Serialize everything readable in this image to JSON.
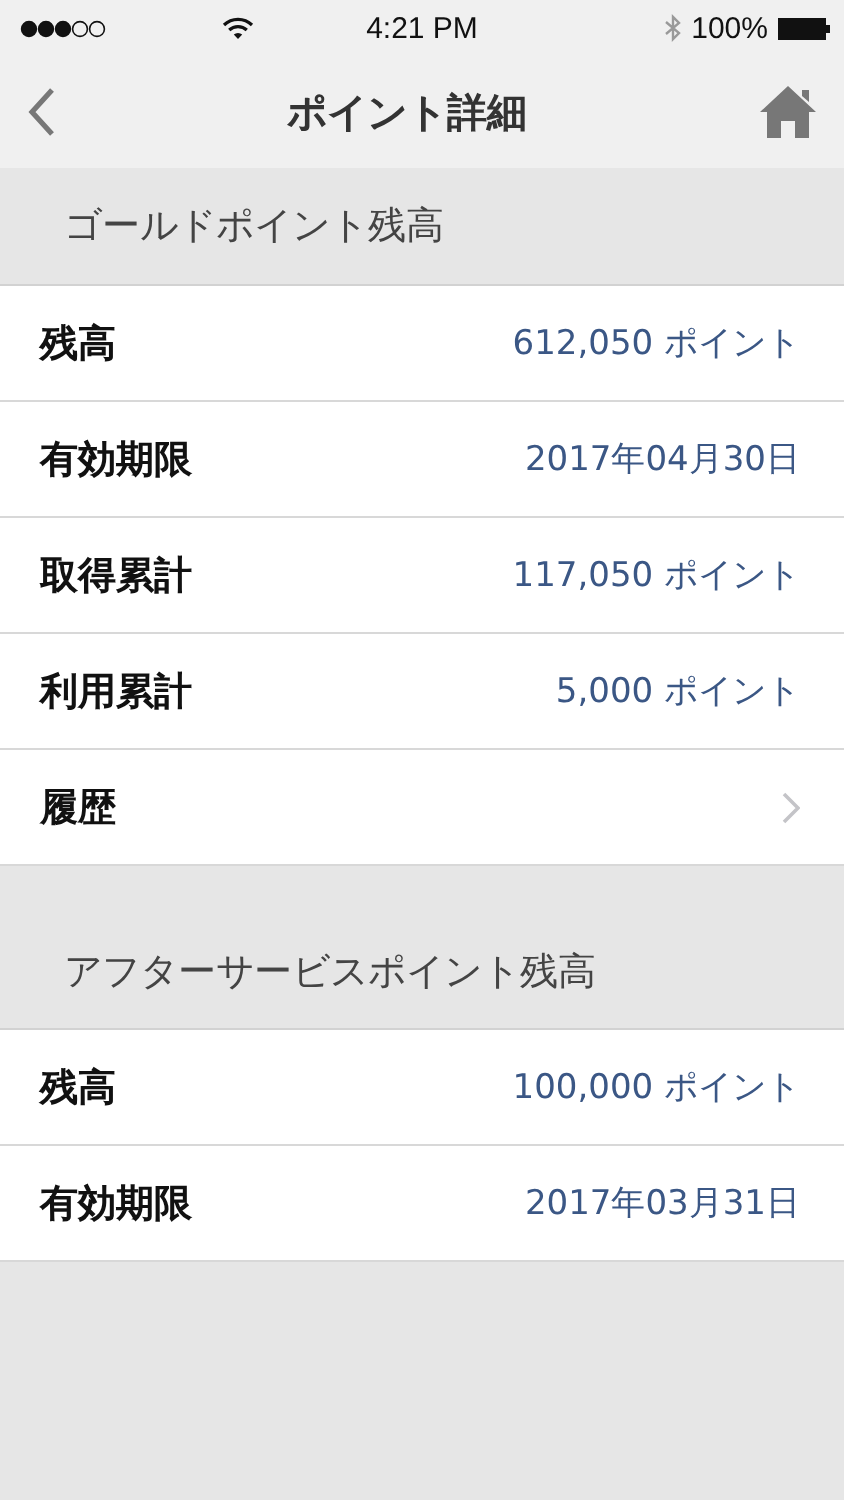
{
  "status_bar": {
    "time": "4:21 PM",
    "battery": "100%"
  },
  "nav": {
    "title": "ポイント詳細"
  },
  "sections": [
    {
      "title": "ゴールドポイント残高",
      "rows": [
        {
          "kind": "value",
          "label": "残高",
          "value": "612,050 ポイント"
        },
        {
          "kind": "value",
          "label": "有効期限",
          "value": "2017年04月30日"
        },
        {
          "kind": "value",
          "label": "取得累計",
          "value": "117,050 ポイント"
        },
        {
          "kind": "value",
          "label": "利用累計",
          "value": "5,000 ポイント"
        },
        {
          "kind": "link",
          "label": "履歴"
        }
      ]
    },
    {
      "title": "アフターサービスポイント残高",
      "rows": [
        {
          "kind": "value",
          "label": "残高",
          "value": "100,000 ポイント"
        },
        {
          "kind": "value",
          "label": "有効期限",
          "value": "2017年03月31日"
        }
      ]
    }
  ]
}
